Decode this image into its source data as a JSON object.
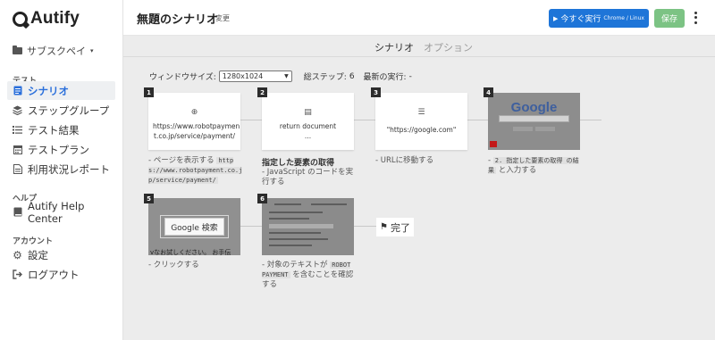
{
  "app": {
    "logo_text": "Autify"
  },
  "sidebar": {
    "workspace": "サブスクペイ",
    "section_test": "テスト",
    "test_items": [
      {
        "label": "シナリオ",
        "icon": "scenario-icon"
      },
      {
        "label": "ステップグループ",
        "icon": "layers-icon"
      },
      {
        "label": "テスト結果",
        "icon": "list-icon"
      },
      {
        "label": "テストプラン",
        "icon": "calendar-icon"
      },
      {
        "label": "利用状況レポート",
        "icon": "report-icon"
      }
    ],
    "section_help": "ヘルプ",
    "help_items": [
      {
        "label": "Autify Help Center",
        "icon": "book-icon"
      }
    ],
    "section_account": "アカウント",
    "account_items": [
      {
        "label": "設定",
        "icon": "gear-icon"
      },
      {
        "label": "ログアウト",
        "icon": "logout-icon"
      }
    ]
  },
  "header": {
    "title": "無題のシナリオ",
    "change_link": "変更",
    "run_label": "今すぐ実行",
    "run_sub": "Chrome / Linux",
    "save_label": "保存"
  },
  "tabs": [
    {
      "label": "シナリオ"
    },
    {
      "label": "オプション"
    }
  ],
  "info": {
    "window_size_label": "ウィンドウサイズ:",
    "window_size_value": "1280x1024",
    "total_steps_label": "総ステップ:",
    "total_steps": "6",
    "last_run_label": "最新の実行:",
    "last_run": "-"
  },
  "steps": [
    {
      "num": "1",
      "card_lines": [
        "https://www.robotpaymen",
        "t.co.jp/service/payment/"
      ],
      "caption_prefix": "- ページを表示する",
      "caption_code": "https://www.robotpayment.co.jp/service/payment/"
    },
    {
      "num": "2",
      "card_lines": [
        "return document",
        "..."
      ],
      "title": "指定した要素の取得",
      "caption": "- JavaScript のコードを実行する"
    },
    {
      "num": "3",
      "card_lines": [
        "\"https://google.com\""
      ],
      "caption": "- URLに移動する"
    },
    {
      "num": "4",
      "thumb_text": "Google",
      "caption_prefix": "-",
      "caption_code": "2. 指定した要素の取得 の結果",
      "caption_suffix": "と入力する"
    },
    {
      "num": "5",
      "thumb_text": "Google 検索",
      "thumb_sub": "vなお試しください。 お手伝",
      "caption": "- クリックする"
    },
    {
      "num": "6",
      "caption_prefix": "- 対象のテキストが",
      "caption_code": "ROBOT PAYMENT",
      "caption_suffix": "を含むことを確認する"
    }
  ],
  "done_label": "完了",
  "colors": {
    "primary": "#1e75d8",
    "save": "#7cc384",
    "active_nav": "#2a6fdb"
  }
}
